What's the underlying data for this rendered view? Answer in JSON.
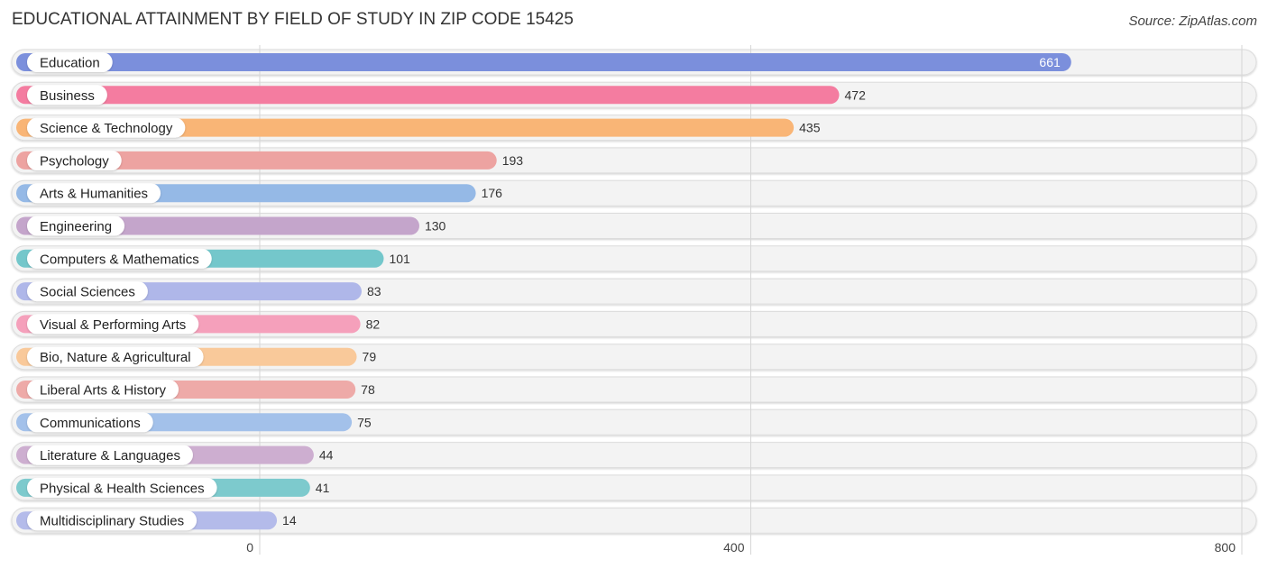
{
  "header": {
    "title": "EDUCATIONAL ATTAINMENT BY FIELD OF STUDY IN ZIP CODE 15425",
    "source": "Source: ZipAtlas.com"
  },
  "chart_data": {
    "type": "bar",
    "orientation": "horizontal",
    "title": "EDUCATIONAL ATTAINMENT BY FIELD OF STUDY IN ZIP CODE 15425",
    "xlabel": "",
    "ylabel": "",
    "xlim": [
      0,
      800
    ],
    "xticks": [
      0,
      400,
      800
    ],
    "grid": true,
    "categories": [
      "Education",
      "Business",
      "Science & Technology",
      "Psychology",
      "Arts & Humanities",
      "Engineering",
      "Computers & Mathematics",
      "Social Sciences",
      "Visual & Performing Arts",
      "Bio, Nature & Agricultural",
      "Liberal Arts & History",
      "Communications",
      "Literature & Languages",
      "Physical & Health Sciences",
      "Multidisciplinary Studies"
    ],
    "values": [
      661,
      472,
      435,
      193,
      176,
      130,
      101,
      83,
      82,
      79,
      78,
      75,
      44,
      41,
      14
    ],
    "colors": [
      "#7b8fdc",
      "#f47ca0",
      "#f9b576",
      "#eda3a1",
      "#95b9e6",
      "#c4a5cb",
      "#74c7cb",
      "#afb7e9",
      "#f5a0bb",
      "#f9c99a",
      "#eeaaa8",
      "#a3c1ea",
      "#cdaed0",
      "#7dcacd",
      "#b4bbea"
    ]
  }
}
